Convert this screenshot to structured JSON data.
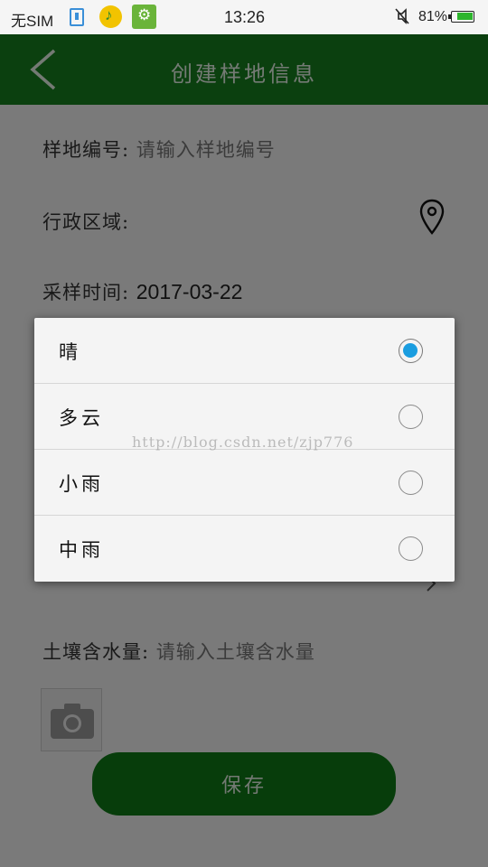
{
  "status_bar": {
    "carrier": "无SIM",
    "time": "13:26",
    "battery_percent": "81%",
    "battery_level": 0.81,
    "icons": [
      "usb-icon",
      "music-app-icon",
      "usb-debug-icon",
      "mute-icon",
      "battery-icon"
    ]
  },
  "app_bar": {
    "back_icon": "chevron-left-icon",
    "title": "创建样地信息"
  },
  "form": {
    "plot_number": {
      "label": "样地编号:",
      "placeholder": "请输入样地编号"
    },
    "admin_region": {
      "label": "行政区域:",
      "icon": "location-pin-icon"
    },
    "sampling_time": {
      "label": "采样时间:",
      "value": "2017-03-22"
    },
    "soil_moisture": {
      "label": "土壤含水量:",
      "placeholder": "请输入土壤含水量"
    },
    "photo": {
      "icon": "camera-icon"
    },
    "save_label": "保存"
  },
  "dialog": {
    "options": [
      {
        "label": "晴",
        "checked": true
      },
      {
        "label": "多云",
        "checked": false
      },
      {
        "label": "小雨",
        "checked": false
      },
      {
        "label": "中雨",
        "checked": false
      }
    ],
    "accent_color": "#1a9de0"
  },
  "watermark": "http://blog.csdn.net/zjp776",
  "colors": {
    "app_bar": "#16801f",
    "save_button": "#0e7a16"
  }
}
